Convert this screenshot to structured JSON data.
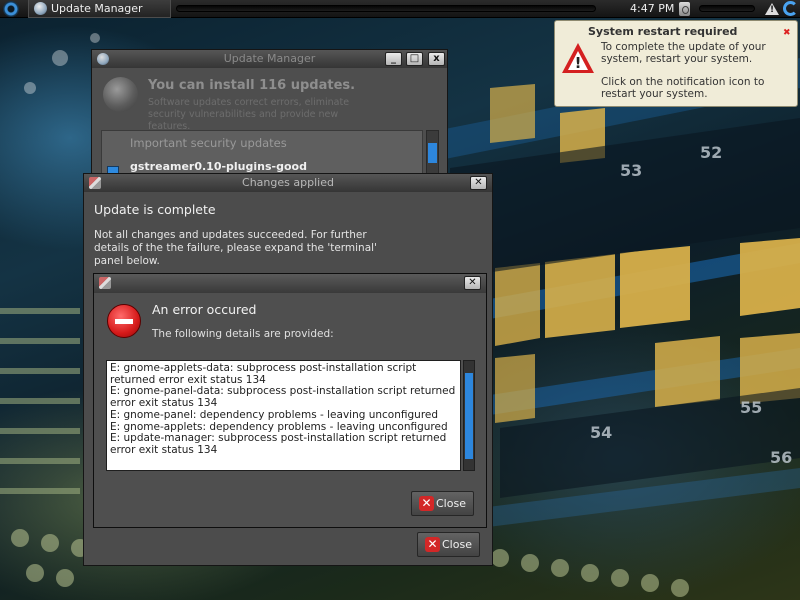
{
  "panel": {
    "taskbar_window_title": "Update Manager",
    "clock": "4:47 PM",
    "icons": [
      "menu-icon",
      "trash-icon",
      "warning-icon",
      "refresh-icon"
    ]
  },
  "notification": {
    "title": "System restart required",
    "body_line1": "To complete the update of your system, restart your system.",
    "body_line2": "Click on the notification icon to restart your system.",
    "icon": "warning-icon"
  },
  "update_manager": {
    "title": "Update Manager",
    "heading": "You can install 116 updates.",
    "description": "Software updates correct errors, eliminate security vulnerabilities and provide new features.",
    "list_header": "Important security updates",
    "list_item": "gstreamer0.10-plugins-good",
    "buttons": [
      "_",
      "□",
      "x"
    ]
  },
  "changes_applied": {
    "title": "Changes applied",
    "heading": "Update is complete",
    "description": "Not all changes and updates succeeded. For further details of the the failure, please expand the 'terminal' panel below.",
    "close_label": "Close"
  },
  "error_dialog": {
    "heading": "An error occured",
    "subheading": "The following details are provided:",
    "details": "E: gnome-applets-data: subprocess post-installation script returned error exit status 134\nE: gnome-panel-data: subprocess post-installation script returned error exit status 134\nE: gnome-panel: dependency problems - leaving unconfigured\nE: gnome-applets: dependency problems - leaving unconfigured\nE: update-manager: subprocess post-installation script returned error exit status 134",
    "close_label": "Close"
  },
  "colors": {
    "accent": "#2d86dc",
    "error": "#d61a1a",
    "notification_bg": "#f0ecd8"
  }
}
